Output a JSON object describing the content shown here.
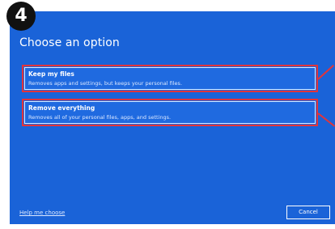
{
  "step_badge": "4",
  "page_title": "Choose an option",
  "options": [
    {
      "title": "Keep my files",
      "description": "Removes apps and settings, but keeps your personal files."
    },
    {
      "title": "Remove everything",
      "description": "Removes all of your personal files, apps, and settings."
    }
  ],
  "footer": {
    "help_link": "Help me choose",
    "cancel_label": "Cancel"
  },
  "colors": {
    "dialog_background": "#1a63d8",
    "highlight_border": "#e2343a",
    "badge": "#111111"
  }
}
